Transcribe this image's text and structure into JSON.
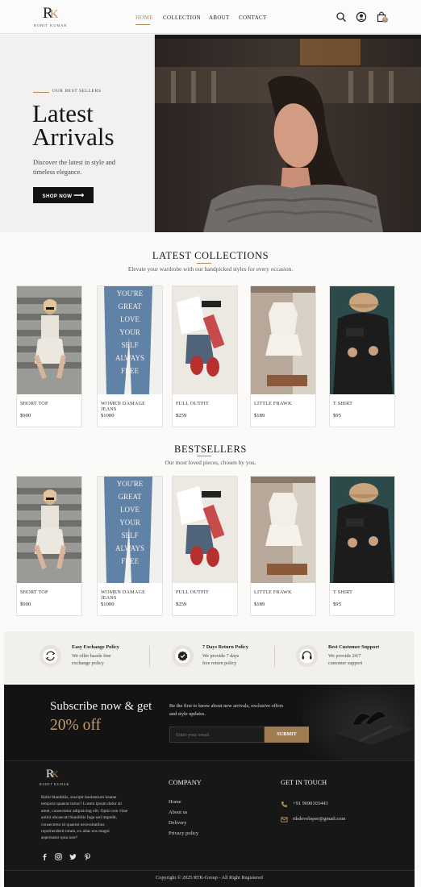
{
  "brand": {
    "mark": "R",
    "mark_accent": "K",
    "name": "ROHIT KUMAR"
  },
  "nav": {
    "items": [
      "HOME",
      "COLLECTION",
      "ABOUT",
      "CONTACT"
    ],
    "active": "HOME"
  },
  "icons": {
    "search": "search-icon",
    "profile": "user-icon",
    "cart": "shopping-bag-icon"
  },
  "cart": {
    "count": "0"
  },
  "hero": {
    "eyebrow": "OUR BEST SELLERS",
    "title_line1": "Latest",
    "title_line2": "Arrivals",
    "subtitle": "Discover the latest in style and timeless elegance.",
    "button": "SHOP NOW",
    "button_icon": "arrow-right-icon"
  },
  "latest": {
    "title": "LATEST COLLECTIONS",
    "subtitle": "Elevate your wardrobe with our handpicked styles for every occasion.",
    "products": [
      {
        "name": "SHORT TOP",
        "price": "$900"
      },
      {
        "name": "WOMEN DAMAGE JEANS",
        "price": "$1000"
      },
      {
        "name": "FULL OUTFIT",
        "price": "$259"
      },
      {
        "name": "LITTLE FRAWK",
        "price": "$189"
      },
      {
        "name": "T SHIRT",
        "price": "$95"
      }
    ]
  },
  "bestsellers": {
    "title": "BESTSELLERS",
    "subtitle": "Our most loved pieces, chosen by you.",
    "products": [
      {
        "name": "SHORT TOP",
        "price": "$900"
      },
      {
        "name": "WOMEN DAMAGE JEANS",
        "price": "$1000"
      },
      {
        "name": "FULL OUTFIT",
        "price": "$259"
      },
      {
        "name": "LITTLE FRAWK",
        "price": "$189"
      },
      {
        "name": "T SHIRT",
        "price": "$95"
      }
    ]
  },
  "jeans_text": [
    "YOU'RE",
    "GREAT",
    "LOVE",
    "YOUR",
    "SELF",
    "ALWAYS",
    "FREE"
  ],
  "features": [
    {
      "icon": "exchange-icon",
      "title": "Easy Exchange Policy",
      "text1": "We offer hassle free",
      "text2": "exchange policy"
    },
    {
      "icon": "checkmark-badge-icon",
      "title": "7 Days Return Policy",
      "text1": "We provide 7 days",
      "text2": "free return policy"
    },
    {
      "icon": "headset-icon",
      "title": "Best Customer Support",
      "text1": "We provide 24/7",
      "text2": "customer support"
    }
  ],
  "subscribe": {
    "heading": "Subscribe now & get",
    "offer": "20% off",
    "text": "Be the first to know about new arrivals, exclusive offers and style updates.",
    "placeholder": "Enter your email",
    "button": "SUBMIT"
  },
  "footer": {
    "about": "Rohit blanditiis, suscipit laudantium beatae tempora quaerat tortor? Lorem ipsum dolor sit amet, consectetur adipisicing elit. Optio non vitae animi obcaecati blanditiis fuga sed impedit, consectetur id quaerat necessitatibus reprehenderit totam, ex alias eos magni aspernatur quia iure?",
    "company_title": "COMPANY",
    "links": [
      "Home",
      "About us",
      "Delivery",
      "Privacy policy"
    ],
    "contact_title": "GET IN TOUCH",
    "phone": "+91 9690103443",
    "email": "rtkdeveloper@gmail.com",
    "social": [
      "facebook-icon",
      "instagram-icon",
      "twitter-icon",
      "pinterest-icon"
    ],
    "copyright": "Copyright © 2025 RTK-Group - All Right Registered"
  },
  "colors": {
    "accent": "#b08a5e",
    "dark": "#131313",
    "offer": "#c59d6c"
  }
}
